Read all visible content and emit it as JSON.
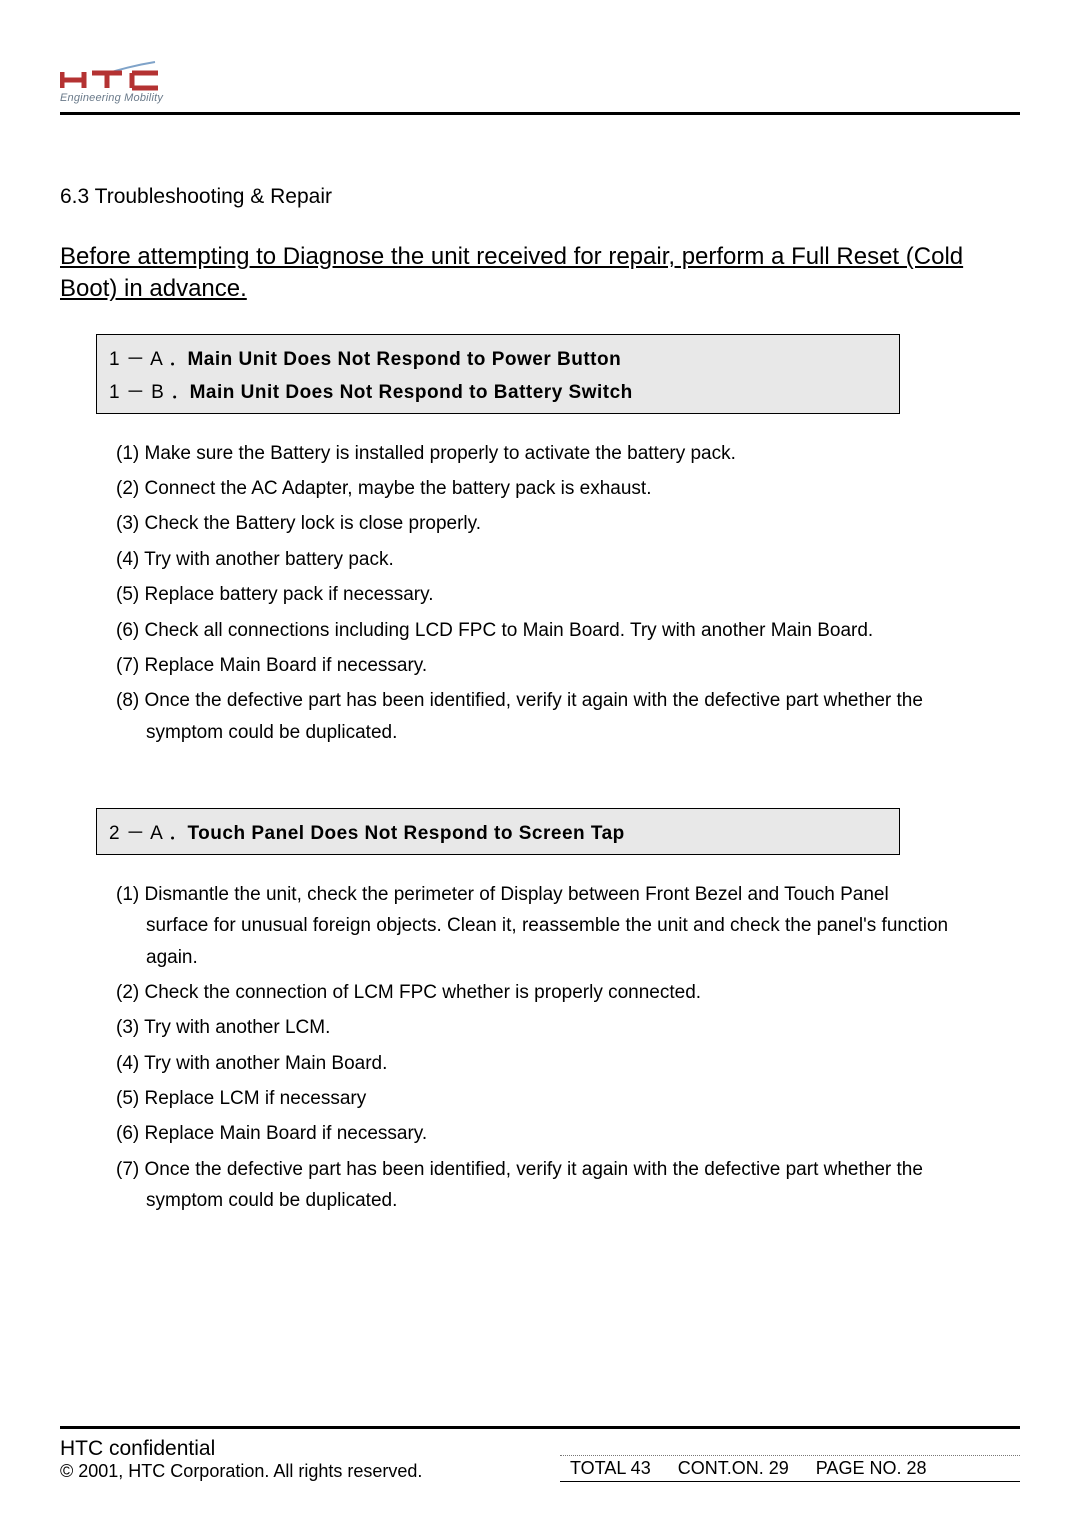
{
  "logo": {
    "subline": "Engineering Mobility"
  },
  "section_title": "6.3 Troubleshooting & Repair",
  "intro": "Before attempting to Diagnose the unit received for repair, perform a Full Reset (Cold Boot) in advance.",
  "issue1": {
    "lineA_prefix": "1 － A ．",
    "lineA_title": "Main Unit Does Not Respond to Power Button",
    "lineB_prefix": "1 －  B  ．",
    "lineB_title": "Main Unit Does Not Respond to Battery Switch",
    "steps": [
      "(1) Make sure the Battery is installed properly to activate the battery pack.",
      "(2) Connect the AC Adapter, maybe the battery pack is exhaust.",
      "(3) Check the Battery lock is close properly.",
      "(4) Try with another battery pack.",
      "(5) Replace battery pack if necessary.",
      "(6) Check all connections including LCD FPC to Main Board. Try with another Main Board.",
      "(7) Replace Main Board if necessary.",
      "(8) Once the defective part has been identified, verify it again with the defective part whether the symptom could be duplicated."
    ]
  },
  "issue2": {
    "lineA_prefix": "2 －  A  ．",
    "lineA_title": "Touch Panel Does Not Respond to Screen Tap",
    "steps": [
      "(1) Dismantle the unit, check the perimeter of Display between Front Bezel and Touch Panel surface for unusual foreign objects. Clean it, reassemble the unit and check the panel's function again.",
      "(2) Check the connection of LCM FPC whether is properly connected.",
      "(3) Try with another LCM.",
      "(4) Try with another Main Board.",
      "(5) Replace LCM if necessary",
      "(6) Replace Main Board if necessary.",
      "(7) Once the defective part has been identified, verify it again with the defective part whether the symptom could be duplicated."
    ]
  },
  "footer": {
    "confidential": "HTC confidential",
    "copyright": "© 2001, HTC Corporation. All rights reserved.",
    "total": "TOTAL 43",
    "cont": "CONT.ON. 29",
    "page": "PAGE NO. 28"
  }
}
